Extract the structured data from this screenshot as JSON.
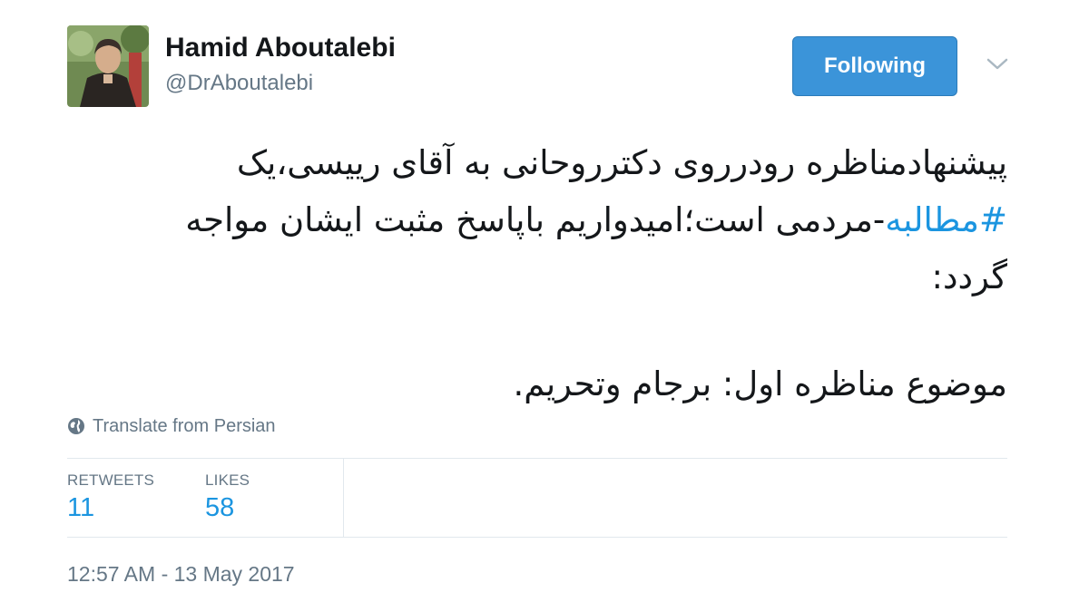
{
  "author": {
    "name": "Hamid Aboutalebi",
    "handle": "@DrAboutalebi"
  },
  "follow_button": {
    "label": "Following"
  },
  "tweet": {
    "line1": "پیشنهادمناظره رودرروی دکترروحانی به آقای رییسی،یک",
    "line2_hashtag": "#مطالبه",
    "line2_rest": "-مردمی است؛امیدواریم باپاسخ مثبت ایشان مواجه",
    "line3": "گردد:",
    "line4": "موضوع مناظره اول: برجام وتحریم."
  },
  "translate": {
    "label": "Translate from Persian",
    "icon": "globe-icon"
  },
  "stats": {
    "retweets_label": "RETWEETS",
    "retweets_value": "11",
    "likes_label": "LIKES",
    "likes_value": "58"
  },
  "timestamp": "12:57 AM - 13 May 2017",
  "colors": {
    "accent": "#1b95e0",
    "button": "#3b94d9",
    "muted": "#657786",
    "border": "#e1e8ed"
  }
}
